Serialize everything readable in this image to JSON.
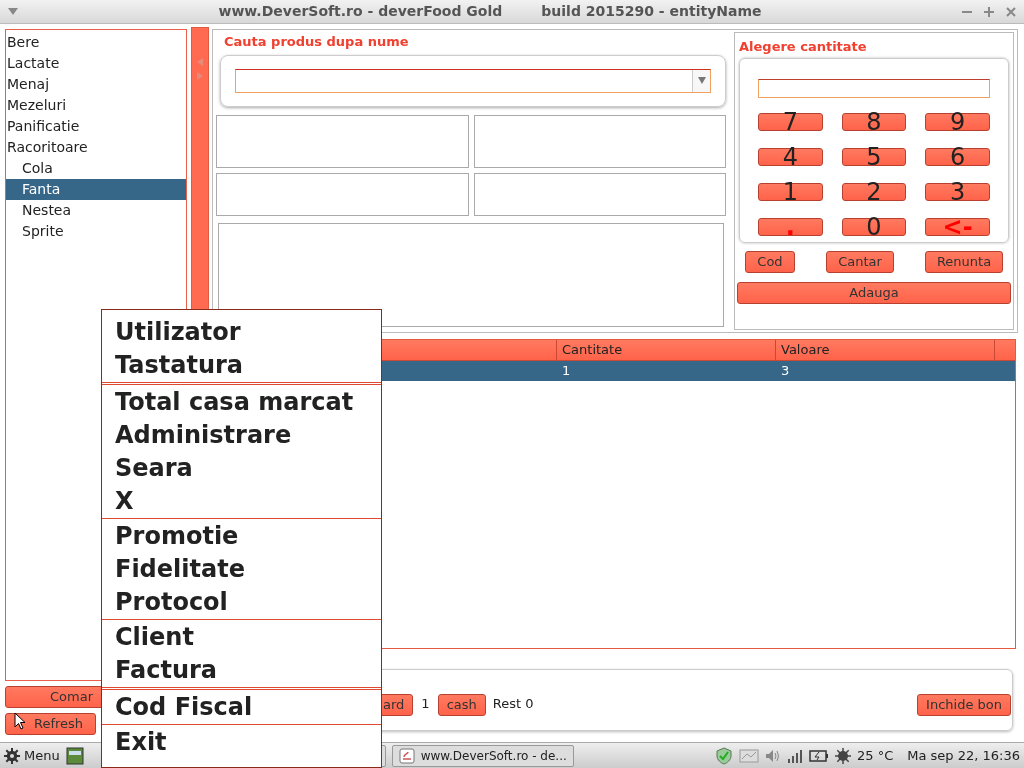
{
  "window": {
    "title": "www.DeverSoft.ro - deverFood Gold        build 2015290 - entityName"
  },
  "categories": [
    {
      "label": "Bere",
      "selected": false
    },
    {
      "label": "Lactate",
      "selected": false
    },
    {
      "label": "Menaj",
      "selected": false
    },
    {
      "label": "Mezeluri",
      "selected": false
    },
    {
      "label": "Panificatie",
      "selected": false
    },
    {
      "label": "Racoritoare",
      "selected": false,
      "children": [
        {
          "label": "Cola",
          "selected": false
        },
        {
          "label": "Fanta",
          "selected": true
        },
        {
          "label": "Nestea",
          "selected": false
        },
        {
          "label": "Sprite",
          "selected": false
        }
      ]
    }
  ],
  "search": {
    "label": "Cauta produs dupa nume"
  },
  "quantity": {
    "label": "Alegere cantitate",
    "keys": [
      {
        "label": "7",
        "kind": "digit"
      },
      {
        "label": "8",
        "kind": "digit"
      },
      {
        "label": "9",
        "kind": "digit"
      },
      {
        "label": "4",
        "kind": "digit"
      },
      {
        "label": "5",
        "kind": "digit"
      },
      {
        "label": "6",
        "kind": "digit"
      },
      {
        "label": "1",
        "kind": "digit"
      },
      {
        "label": "2",
        "kind": "digit"
      },
      {
        "label": "3",
        "kind": "digit"
      },
      {
        "label": ".",
        "kind": "symbol"
      },
      {
        "label": "0",
        "kind": "digit"
      },
      {
        "label": "<-",
        "kind": "symbol"
      }
    ],
    "actions": [
      "Cod",
      "Cantar",
      "Renunta"
    ],
    "add": "Adauga"
  },
  "table": {
    "columns": [
      "Cantitate",
      "Valoare"
    ],
    "rows": [
      {
        "cells": [
          "1",
          "3"
        ],
        "selected": true
      }
    ]
  },
  "left_buttons": [
    "Comar",
    "Refresh"
  ],
  "payment": {
    "card": "ard",
    "count": "1",
    "cash": "cash",
    "rest": "Rest 0",
    "close": "Inchide bon"
  },
  "menu": {
    "groups": [
      {
        "items": [
          "Utilizator",
          "Tastatura"
        ]
      },
      {
        "kind": "double",
        "items": [
          "Total casa marcat",
          "Administrare",
          "Seara",
          "X"
        ]
      },
      {
        "kind": "single",
        "items": [
          "Promotie",
          "Fidelitate",
          "Protocol"
        ]
      },
      {
        "kind": "single",
        "items": [
          "Client",
          "Factura"
        ]
      },
      {
        "kind": "double",
        "items": [
          "Cod Fiscal"
        ]
      },
      {
        "kind": "single",
        "items": [
          "Exit"
        ]
      }
    ]
  },
  "taskbar": {
    "start": "Menu",
    "window": "www.DeverSoft.ro - de...",
    "temperature": "25 °C",
    "clock": "Ma sep 22, 16:36"
  }
}
